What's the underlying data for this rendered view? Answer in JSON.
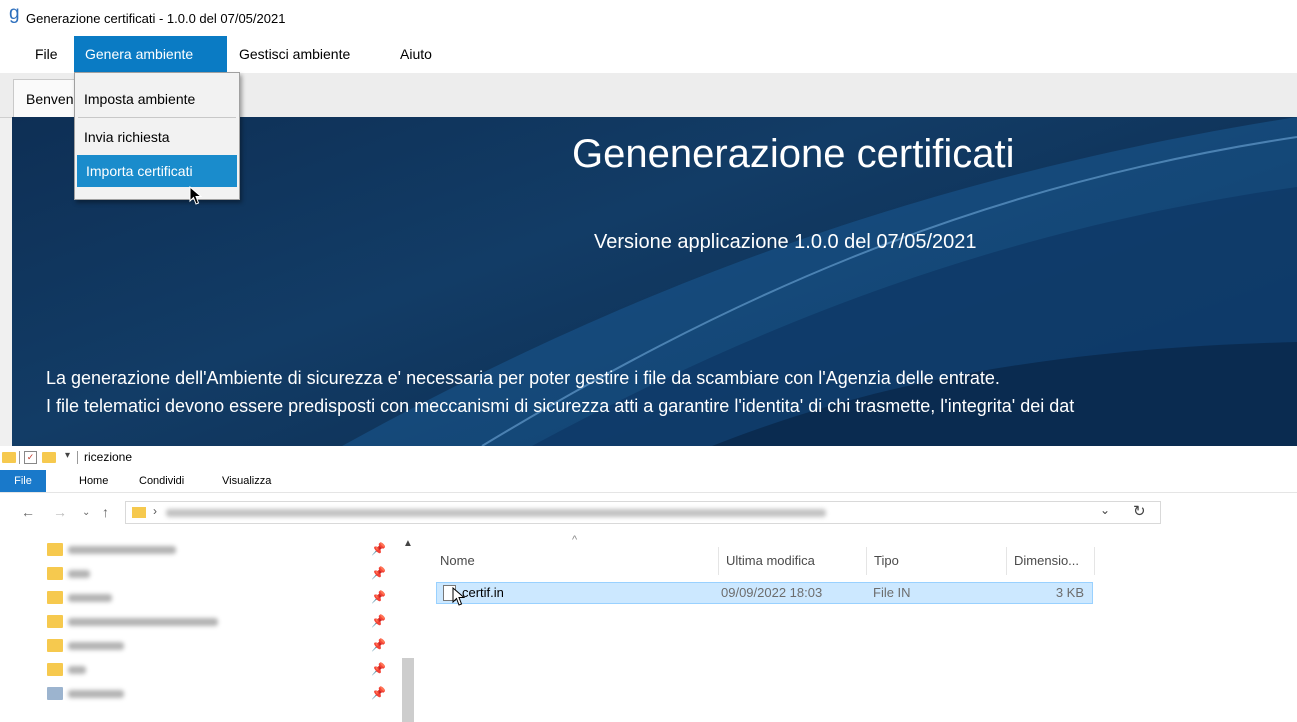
{
  "app": {
    "icon": "g",
    "title": "Generazione certificati - 1.0.0 del 07/05/2021",
    "menu": [
      "File",
      "Genera ambiente",
      "Gestisci ambiente",
      "Aiuto"
    ],
    "tab_label": "Benvenuto",
    "dropdown": [
      "Imposta ambiente",
      "Invia richiesta",
      "Importa certificati"
    ],
    "hero": {
      "title": "Genenerazione certificati",
      "version": "Versione applicazione 1.0.0 del 07/05/2021",
      "line1": "La generazione dell'Ambiente di sicurezza e' necessaria per poter gestire i file da scambiare con l'Agenzia delle entrate.",
      "line2": "I file telematici devono essere predisposti con meccanismi di sicurezza atti a garantire l'identita' di chi trasmette, l'integrita' dei dat"
    },
    "accent_color": "#0a7bc4"
  },
  "explorer": {
    "window_title": "ricezione",
    "ribbon_tabs": [
      "File",
      "Home",
      "Condividi",
      "Visualizza"
    ],
    "columns": [
      "Nome",
      "Ultima modifica",
      "Tipo",
      "Dimensio..."
    ],
    "file": {
      "name": "certif.in",
      "modified": "09/09/2022 18:03",
      "type": "File IN",
      "size": "3 KB"
    },
    "nav_items_count": 7
  }
}
